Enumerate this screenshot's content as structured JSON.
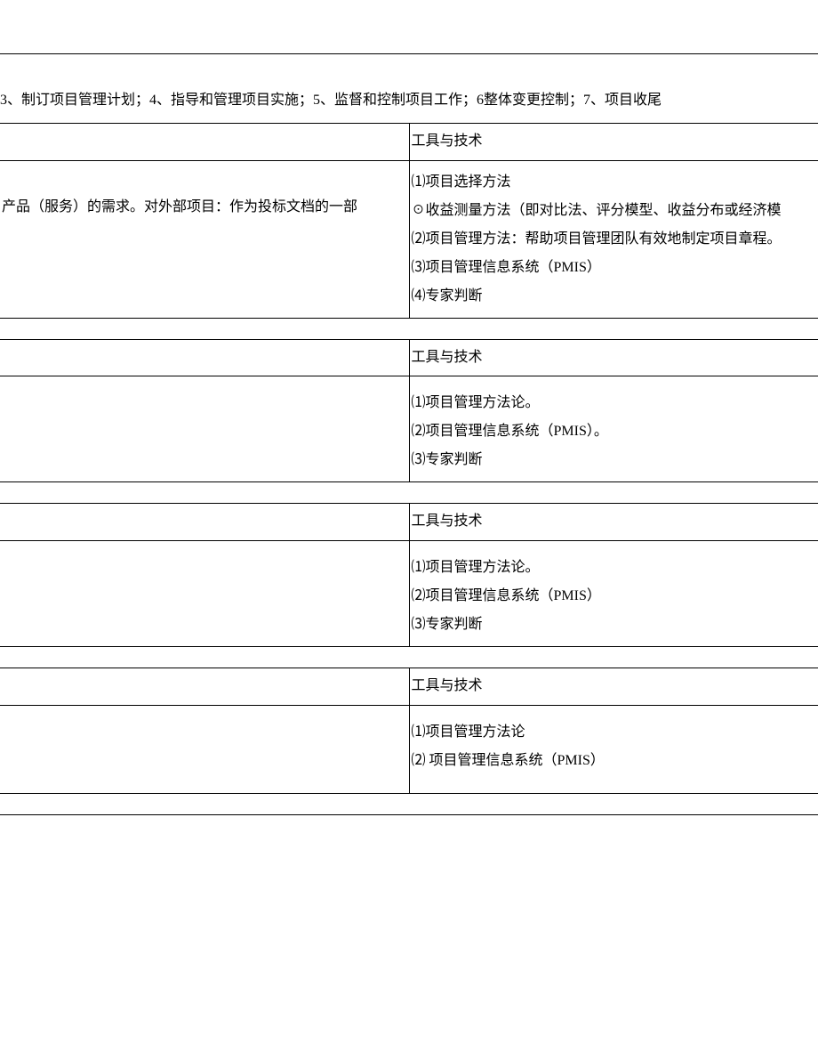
{
  "intro": "3、制订项目管理计划；4、指导和管理项目实施；5、监督和控制项目工作；6整体变更控制；7、项目收尾",
  "columnHeader": "工具与技术",
  "leftText1": "产品（服务）的需求。对外部项目：作为投标文档的一部",
  "section1": "⑴项目选择方法\n☉收益测量方法（即对比法、评分模型、收益分布或经济模\n⑵项目管理方法：帮助项目管理团队有效地制定项目章程。\n⑶项目管理信息系统（PMIS）\n⑷专家判断",
  "section2": "⑴项目管理方法论。\n⑵项目管理信息系统（PMIS）。\n⑶专家判断",
  "section3": "⑴项目管理方法论。\n⑵项目管理信息系统（PMIS）\n⑶专家判断",
  "section4": "⑴项目管理方法论\n⑵ 项目管理信息系统（PMIS）"
}
